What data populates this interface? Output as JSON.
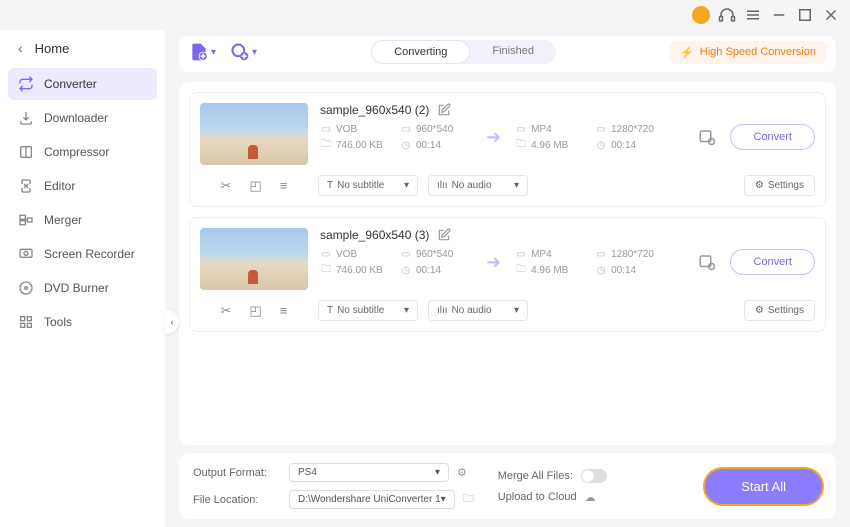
{
  "header": {
    "home_label": "Home"
  },
  "sidebar": {
    "items": [
      {
        "label": "Converter"
      },
      {
        "label": "Downloader"
      },
      {
        "label": "Compressor"
      },
      {
        "label": "Editor"
      },
      {
        "label": "Merger"
      },
      {
        "label": "Screen Recorder"
      },
      {
        "label": "DVD Burner"
      },
      {
        "label": "Tools"
      }
    ]
  },
  "tabs": {
    "converting": "Converting",
    "finished": "Finished"
  },
  "high_speed_label": "High Speed Conversion",
  "files": [
    {
      "title": "sample_960x540 (2)",
      "src": {
        "format": "VOB",
        "resolution": "960*540",
        "size": "746.00 KB",
        "duration": "00:14"
      },
      "dst": {
        "format": "MP4",
        "resolution": "1280*720",
        "size": "4.96 MB",
        "duration": "00:14"
      },
      "subtitle": "No subtitle",
      "audio": "No audio",
      "settings_label": "Settings",
      "convert_label": "Convert"
    },
    {
      "title": "sample_960x540 (3)",
      "src": {
        "format": "VOB",
        "resolution": "960*540",
        "size": "746.00 KB",
        "duration": "00:14"
      },
      "dst": {
        "format": "MP4",
        "resolution": "1280*720",
        "size": "4.96 MB",
        "duration": "00:14"
      },
      "subtitle": "No subtitle",
      "audio": "No audio",
      "settings_label": "Settings",
      "convert_label": "Convert"
    }
  ],
  "footer": {
    "output_format_label": "Output Format:",
    "output_format_value": "PS4",
    "file_location_label": "File Location:",
    "file_location_value": "D:\\Wondershare UniConverter 1",
    "merge_label": "Merge All Files:",
    "upload_label": "Upload to Cloud",
    "start_all_label": "Start All"
  }
}
